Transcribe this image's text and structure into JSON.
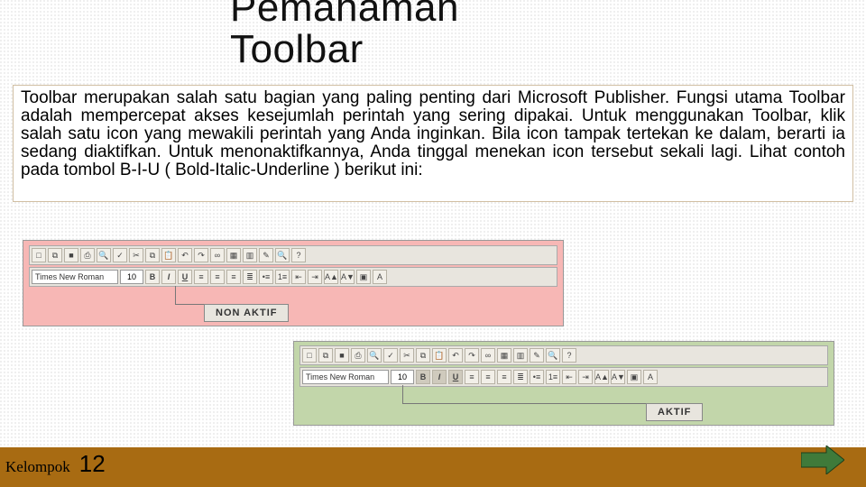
{
  "title_line1": "Pemahaman",
  "title_line2": "Toolbar",
  "description": "Toolbar merupakan salah satu bagian yang paling penting dari Microsoft Publisher. Fungsi utama Toolbar adalah mempercepat akses kesejumlah perintah yang sering dipakai. Untuk menggunakan Toolbar, klik salah satu icon yang mewakili perintah yang Anda inginkan. Bila icon tampak tertekan ke dalam, berarti ia sedang diaktifkan. Untuk menonaktifkannya, Anda tinggal menekan icon tersebut sekali lagi. Lihat contoh pada tombol B-I-U ( Bold-Italic-Underline ) berikut ini:",
  "font_row": {
    "font_name": "Times New Roman",
    "size": "10"
  },
  "labels": {
    "nonaktif": "NON AKTIF",
    "aktif": "AKTIF"
  },
  "footer": {
    "group": "Kelompok",
    "number": "12"
  }
}
